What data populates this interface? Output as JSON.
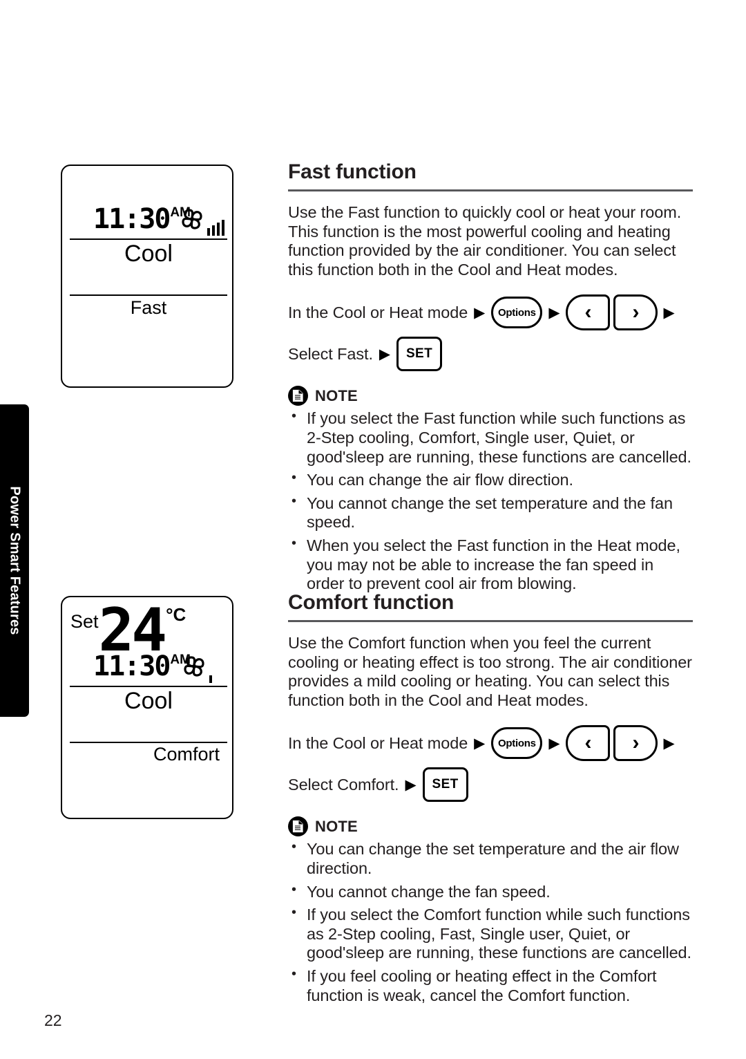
{
  "page": {
    "number": "22",
    "side_tab": "Power Smart Features"
  },
  "displays": [
    {
      "name": "fast-display",
      "time": "11:30",
      "ampm": "AM",
      "fan_bars": 4,
      "mode": "Cool",
      "function": "Fast",
      "set_label": "",
      "temperature": "",
      "unit": ""
    },
    {
      "name": "comfort-display",
      "set_label": "Set",
      "temperature": "24",
      "unit": "°C",
      "time": "11:30",
      "ampm": "AM",
      "fan_bars": 1,
      "mode": "Cool",
      "function": "Comfort"
    }
  ],
  "sections": [
    {
      "title": "Fast function",
      "body": "Use the Fast function to quickly cool or heat your room. This function is the most powerful cooling and heating function provided by the air conditioner. You can select this function both in the Cool and Heat modes.",
      "steps": [
        {
          "text": "In the Cool or Heat mode",
          "buttons": [
            "Options",
            "‹",
            "›"
          ],
          "trailing_arrow": true
        },
        {
          "text": "Select Fast.",
          "buttons": [
            "SET"
          ],
          "trailing_arrow": false
        }
      ],
      "note_label": "NOTE",
      "notes": [
        "If you select the Fast function while such functions as 2-Step cooling, Comfort, Single user, Quiet, or good'sleep are running, these functions are cancelled.",
        "You can change the air flow direction.",
        "You cannot change the set temperature and the fan speed.",
        "When you select the Fast function in the Heat mode, you may not be able to increase the fan speed in order to prevent cool air from blowing."
      ]
    },
    {
      "title": "Comfort function",
      "body": "Use the Comfort function when you feel the current cooling or heating effect is too strong. The air conditioner provides a mild cooling or heating. You can select this function both in the Cool and Heat modes.",
      "steps": [
        {
          "text": "In the Cool or Heat mode",
          "buttons": [
            "Options",
            "‹",
            "›"
          ],
          "trailing_arrow": true
        },
        {
          "text": "Select Comfort.",
          "buttons": [
            "SET"
          ],
          "trailing_arrow": false
        }
      ],
      "note_label": "NOTE",
      "notes": [
        "You can change the set temperature and the air flow direction.",
        "You cannot change the fan speed.",
        "If you select the Comfort function while such functions as 2-Step cooling, Fast, Single user, Quiet, or good'sleep are running, these functions are cancelled.",
        "If you feel cooling or heating effect in the Comfort function is weak, cancel the Comfort function."
      ]
    }
  ],
  "button_labels": {
    "options": "Options",
    "prev": "‹",
    "next": "›",
    "set": "SET"
  },
  "colors": {
    "ink": "#231f20",
    "rule": "#58585b",
    "tab_bg": "#000000",
    "tab_text": "#ffffff",
    "button_shadow": "#bcbec0"
  }
}
